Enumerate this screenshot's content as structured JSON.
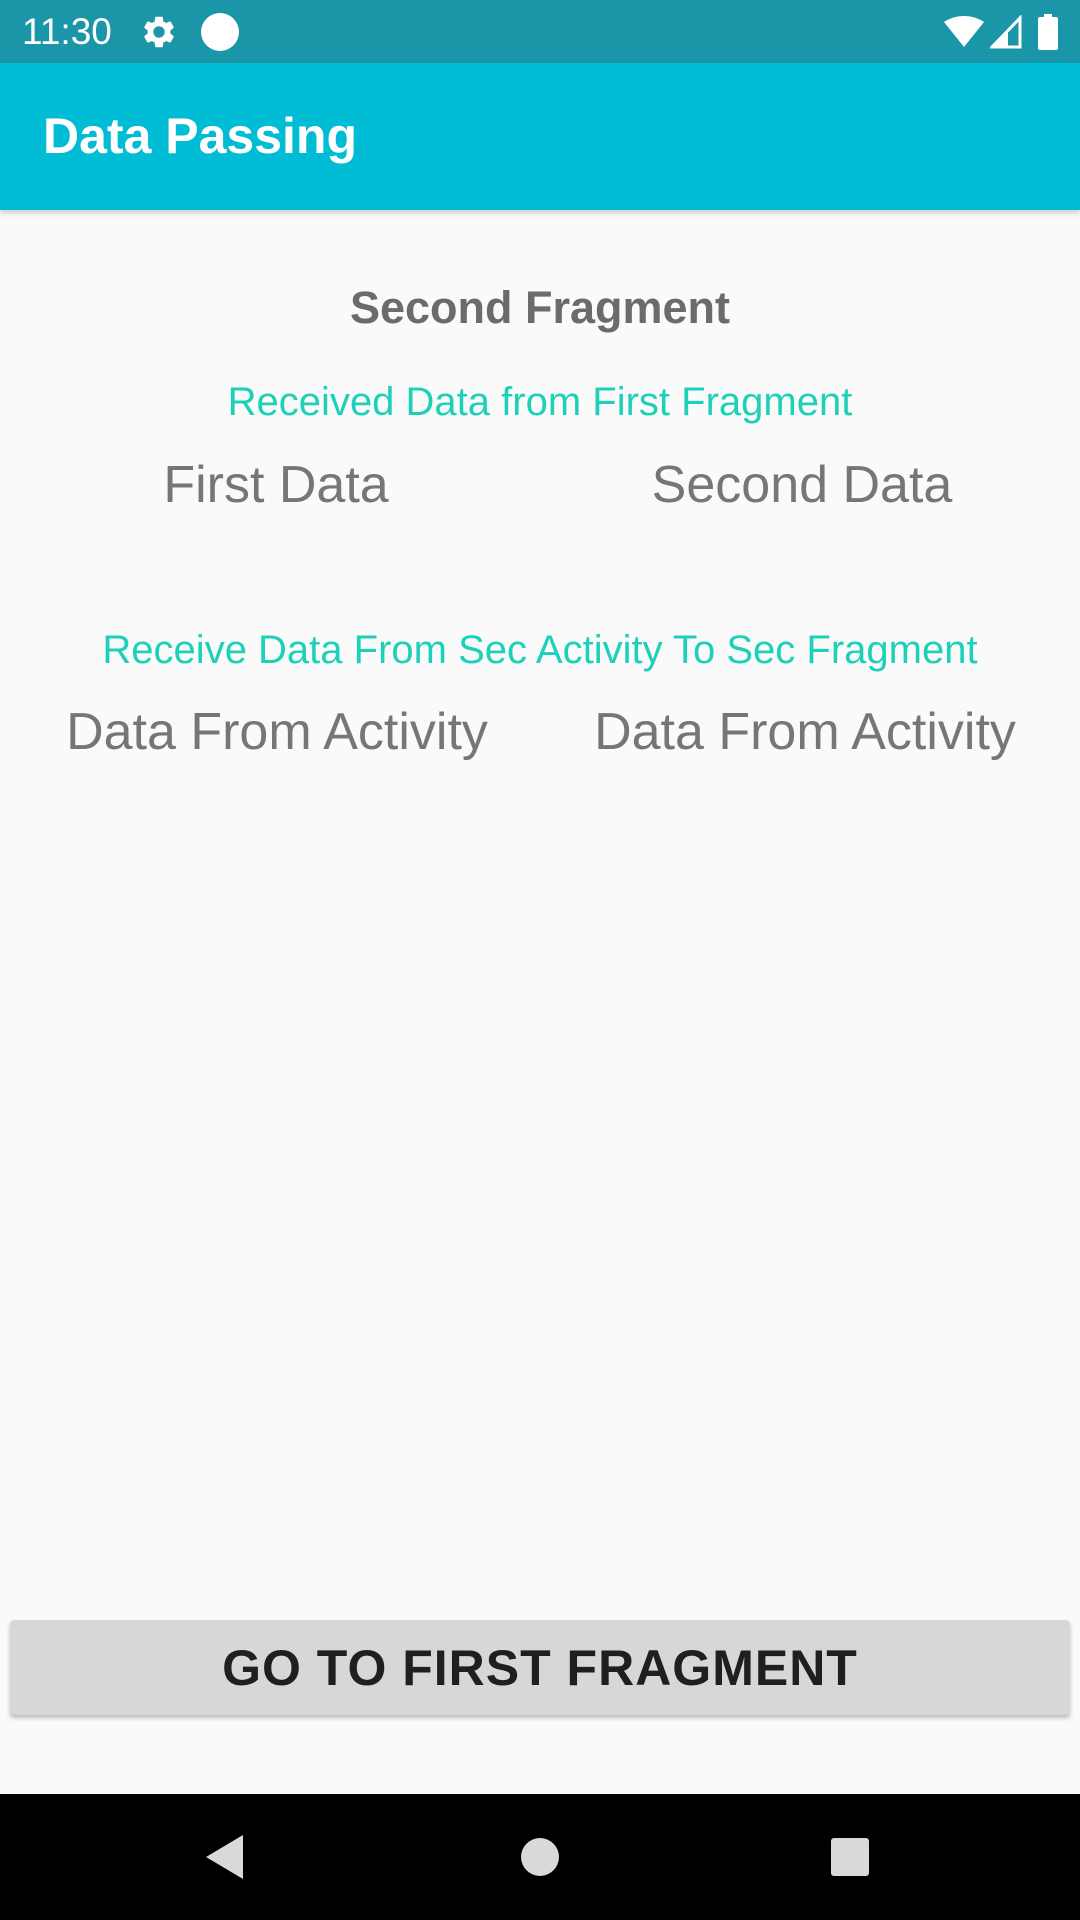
{
  "status_bar": {
    "time": "11:30",
    "icons": [
      "gear-icon",
      "circle-icon",
      "wifi-icon",
      "signal-icon",
      "battery-icon"
    ],
    "background": "#1a96a8"
  },
  "app_bar": {
    "title": "Data Passing",
    "background": "#00bcd4"
  },
  "content": {
    "section_title": "Second Fragment",
    "received_label": "Received Data from First Fragment",
    "first_data": "First Data",
    "second_data": "Second Data",
    "receive_label": "Receive Data From Sec Activity To Sec Fragment",
    "activity_data_1": "Data From Activity",
    "activity_data_2": "Data From Activity",
    "accent_color": "#1dd1b8"
  },
  "button": {
    "label": "GO TO FIRST FRAGMENT"
  },
  "nav_bar": {
    "icons": [
      "back-icon",
      "home-icon",
      "recents-icon"
    ]
  }
}
